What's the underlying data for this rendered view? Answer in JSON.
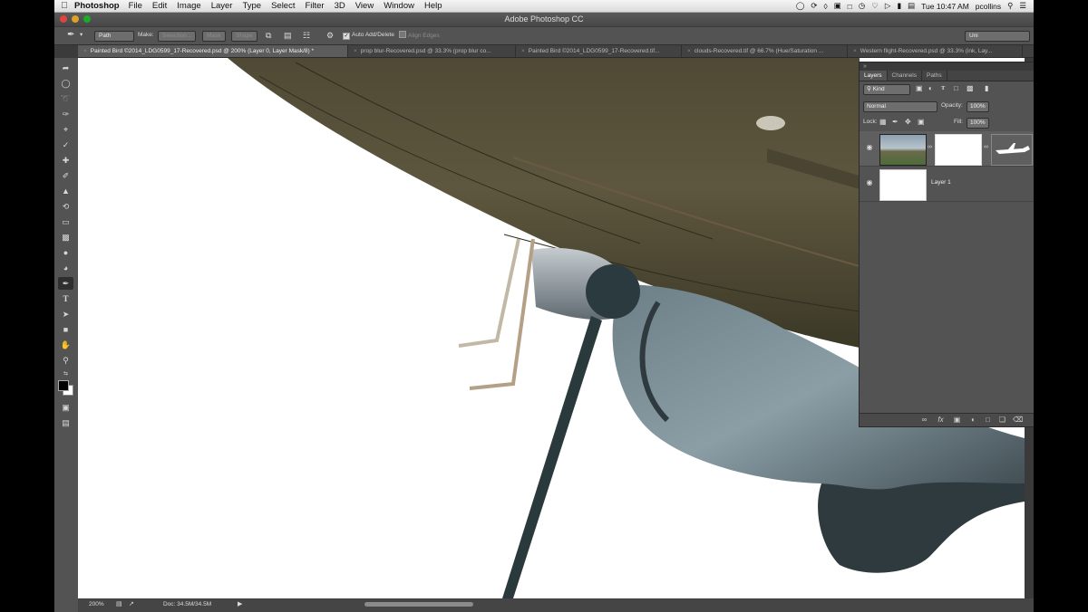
{
  "menubar": {
    "app_name": "Photoshop",
    "menus": [
      "File",
      "Edit",
      "Image",
      "Layer",
      "Type",
      "Select",
      "Filter",
      "3D",
      "View",
      "Window",
      "Help"
    ],
    "clock": "Tue 10:47 AM",
    "user": "pcollins"
  },
  "window": {
    "title": "Adobe Photoshop CC"
  },
  "options": {
    "mode": "Path",
    "make_label": "Make:",
    "selection_btn": "Selection...",
    "mask_btn": "Mask",
    "shape_btn": "Shape",
    "auto_add_delete": "Auto Add/Delete",
    "align_edges": "Align Edges",
    "workspace": "Uni"
  },
  "tabs": [
    "Painted Bird ©2014_LDG0599_17-Recovered.psd @ 200% (Layer 0, Layer Mask/8) *",
    "prop blur-Recovered.psd @ 33.3% (prop blur co...",
    "Painted Bird ©2014_LDG0599_17-Recovered.tif...",
    "clouds-Recovered.tif @ 66.7% (Hue/Saturation ...",
    "Western flight-Recovered.psd @ 33.3% (ink, Lay..."
  ],
  "status": {
    "zoom": "200%",
    "doc": "Doc: 34.5M/34.5M"
  },
  "layers_panel": {
    "tabs": [
      "Layers",
      "Channels",
      "Paths"
    ],
    "filter_kind": "Kind",
    "blend_mode": "Normal",
    "opacity_label": "Opacity:",
    "opacity": "100%",
    "lock_label": "Lock:",
    "fill_label": "Fill:",
    "fill": "100%",
    "layers": [
      {
        "name": ""
      },
      {
        "name": "Layer 1"
      }
    ]
  },
  "colors": {
    "panel_bg": "#535353",
    "app_bg": "#3b3b3b",
    "canvas": "#ffffff",
    "selected_layer": "#5f5f5f"
  }
}
